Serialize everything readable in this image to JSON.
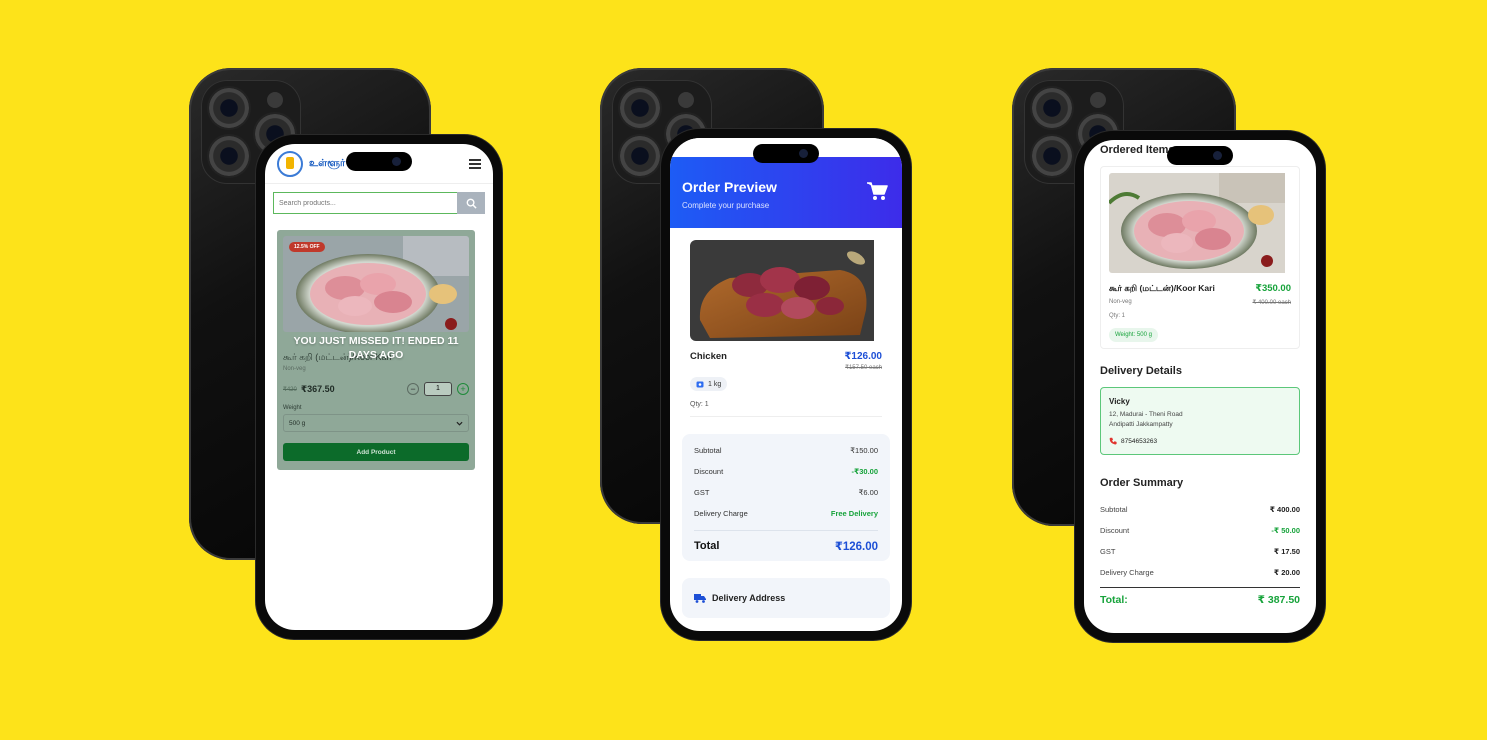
{
  "colors": {
    "background": "#fde31a",
    "accent_blue": "#1d4fd6",
    "accent_green": "#17a33b",
    "phone_dark": "#0a0a0a"
  },
  "phone1": {
    "brand": "உள்ளூர்",
    "search_placeholder": "Search products...",
    "product": {
      "discount_badge": "12.5% OFF",
      "overlay_message": "YOU JUST MISSED IT! ENDED 11 DAYS AGO",
      "name": "கூர் கறி (மட்டன்)/Koor Kari",
      "category": "Non-veg",
      "old_price": "₹420",
      "price": "₹367.50",
      "quantity": "1",
      "weight_label": "Weight",
      "weight_selected": "500 g",
      "add_button": "Add Product"
    }
  },
  "phone2": {
    "title": "Order Preview",
    "subtitle": "Complete your purchase",
    "item": {
      "name": "Chicken",
      "price": "₹126.00",
      "each_price": "₹157.50 each",
      "weight": "1 kg",
      "qty": "Qty: 1"
    },
    "summary": [
      {
        "label": "Subtotal",
        "value": "₹150.00",
        "style": "normal"
      },
      {
        "label": "Discount",
        "value": "-₹30.00",
        "style": "green"
      },
      {
        "label": "GST",
        "value": "₹6.00",
        "style": "normal"
      },
      {
        "label": "Delivery Charge",
        "value": "Free Delivery",
        "style": "green"
      }
    ],
    "total_label": "Total",
    "total_value": "₹126.00",
    "address_heading": "Delivery Address"
  },
  "phone3": {
    "ordered_heading": "Ordered Items",
    "item": {
      "name": "கூர் கறி (மட்டன்)/Koor Kari",
      "category": "Non-veg",
      "qty": "Qty: 1",
      "price": "₹350.00",
      "each_price": "₹ 400.00 each",
      "weight": "Weight: 500 g"
    },
    "delivery_heading": "Delivery Details",
    "delivery": {
      "name": "Vicky",
      "line1": "12, Madurai - Theni Road",
      "line2": "Andipatti Jakkampatty",
      "phone": "8754653263"
    },
    "summary_heading": "Order Summary",
    "summary": [
      {
        "label": "Subtotal",
        "value": "₹ 400.00",
        "style": "normal"
      },
      {
        "label": "Discount",
        "value": "-₹ 50.00",
        "style": "green"
      },
      {
        "label": "GST",
        "value": "₹ 17.50",
        "style": "normal"
      },
      {
        "label": "Delivery Charge",
        "value": "₹ 20.00",
        "style": "normal"
      }
    ],
    "total_label": "Total:",
    "total_value": "₹ 387.50"
  }
}
